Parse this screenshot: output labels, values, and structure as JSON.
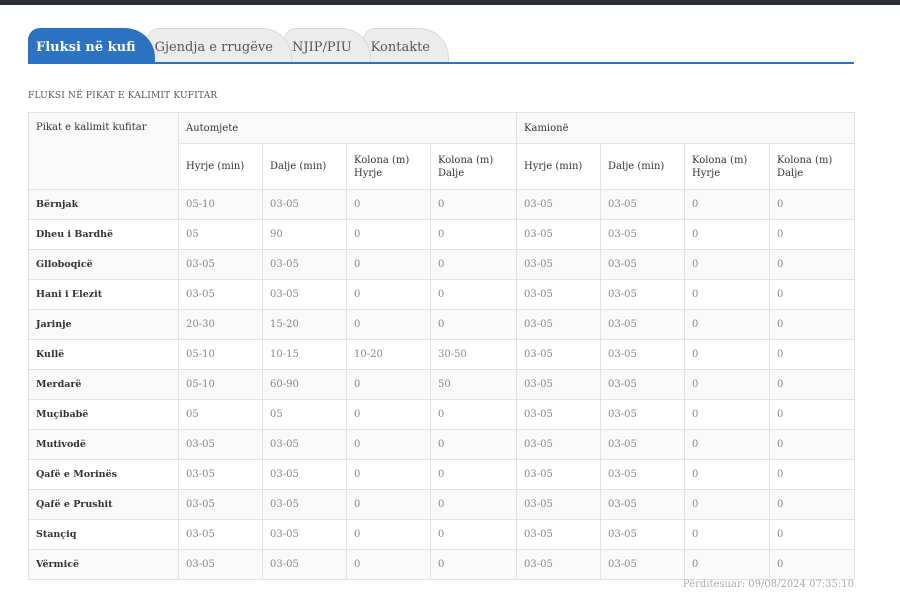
{
  "tabs": [
    {
      "label": "Fluksi në kufi",
      "active": true
    },
    {
      "label": "Gjendja e rrugëve",
      "active": false
    },
    {
      "label": "NJIP/PIU",
      "active": false
    },
    {
      "label": "Kontakte",
      "active": false
    }
  ],
  "section_title": "FLUKSI NË PIKAT E KALIMIT KUFITAR",
  "table": {
    "point_header": "Pikat e kalimit kufitar",
    "group_cars": "Automjete",
    "group_trucks": "Kamionë",
    "sub_headers": [
      "Hyrje (min)",
      "Dalje (min)",
      "Kolona (m) Hyrje",
      "Kolona (m) Dalje",
      "Hyrje (min)",
      "Dalje (min)",
      "Kolona (m) Hyrje",
      "Kolona (m) Dalje"
    ],
    "rows": [
      [
        "Bërnjak",
        "05-10",
        "03-05",
        "0",
        "0",
        "03-05",
        "03-05",
        "0",
        "0"
      ],
      [
        "Dheu i Bardhë",
        "05",
        "90",
        "0",
        "0",
        "03-05",
        "03-05",
        "0",
        "0"
      ],
      [
        "Glloboqicë",
        "03-05",
        "03-05",
        "0",
        "0",
        "03-05",
        "03-05",
        "0",
        "0"
      ],
      [
        "Hani i Elezit",
        "03-05",
        "03-05",
        "0",
        "0",
        "03-05",
        "03-05",
        "0",
        "0"
      ],
      [
        "Jarinje",
        "20-30",
        "15-20",
        "0",
        "0",
        "03-05",
        "03-05",
        "0",
        "0"
      ],
      [
        "Kullë",
        "05-10",
        "10-15",
        "10-20",
        "30-50",
        "03-05",
        "03-05",
        "0",
        "0"
      ],
      [
        "Merdarë",
        "05-10",
        "60-90",
        "0",
        "50",
        "03-05",
        "03-05",
        "0",
        "0"
      ],
      [
        "Muçibabë",
        "05",
        "05",
        "0",
        "0",
        "03-05",
        "03-05",
        "0",
        "0"
      ],
      [
        "Mutivodë",
        "03-05",
        "03-05",
        "0",
        "0",
        "03-05",
        "03-05",
        "0",
        "0"
      ],
      [
        "Qafë e Morinës",
        "03-05",
        "03-05",
        "0",
        "0",
        "03-05",
        "03-05",
        "0",
        "0"
      ],
      [
        "Qafë e Prushit",
        "03-05",
        "03-05",
        "0",
        "0",
        "03-05",
        "03-05",
        "0",
        "0"
      ],
      [
        "Stançiq",
        "03-05",
        "03-05",
        "0",
        "0",
        "03-05",
        "03-05",
        "0",
        "0"
      ],
      [
        "Vërmicë",
        "03-05",
        "03-05",
        "0",
        "0",
        "03-05",
        "03-05",
        "0",
        "0"
      ]
    ]
  },
  "updated": "Përditesuar: 09/08/2024 07:35:10",
  "colors": {
    "accent": "#2b73c1",
    "topbar": "#2c2f36"
  }
}
